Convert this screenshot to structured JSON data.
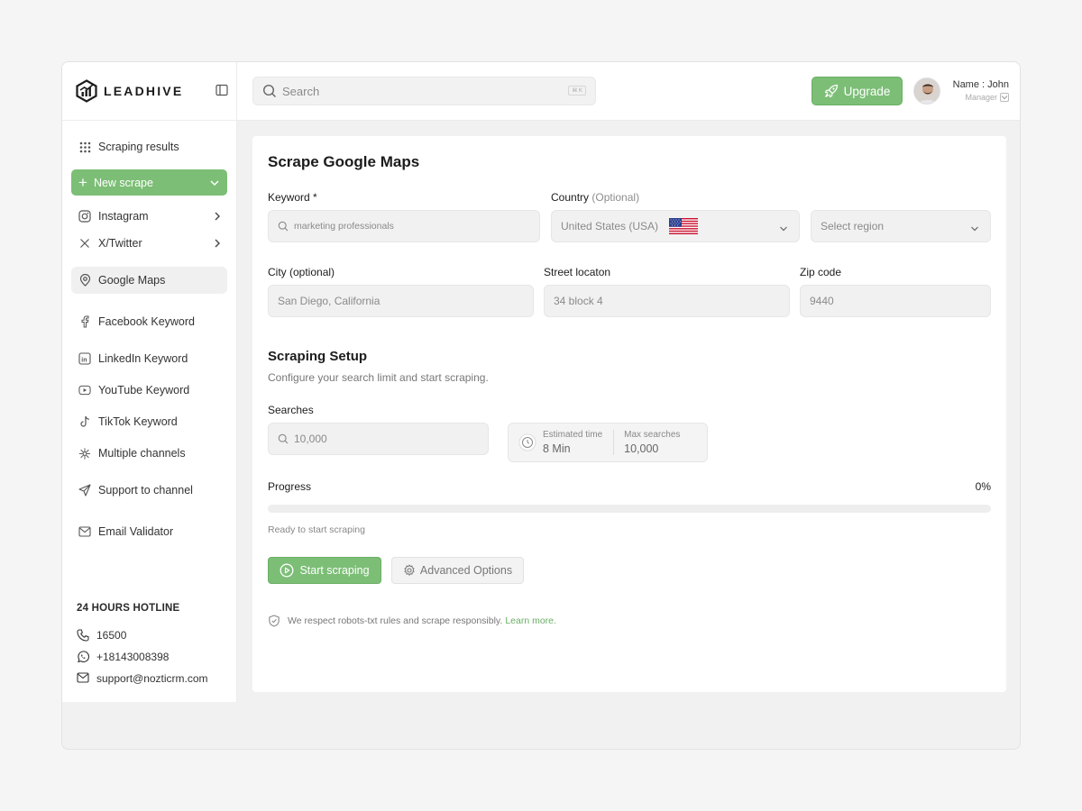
{
  "brand": {
    "name": "LEADHIVE"
  },
  "sidebar": {
    "scraping_results": "Scraping results",
    "new_scrape": "New scrape",
    "items": [
      {
        "label": "Instagram",
        "icon": "instagram-icon"
      },
      {
        "label": "X/Twitter",
        "icon": "x-twitter-icon"
      },
      {
        "label": "Google Maps",
        "icon": "map-pin-icon"
      },
      {
        "label": "Facebook Keyword",
        "icon": "facebook-icon"
      },
      {
        "label": "LinkedIn Keyword",
        "icon": "linkedin-icon"
      },
      {
        "label": "YouTube Keyword",
        "icon": "youtube-icon"
      },
      {
        "label": "TikTok Keyword",
        "icon": "tiktok-icon"
      },
      {
        "label": "Multiple channels",
        "icon": "network-icon"
      },
      {
        "label": "Support to channel",
        "icon": "send-icon"
      },
      {
        "label": "Email Validator",
        "icon": "mail-icon"
      }
    ],
    "hotline": {
      "title": "24 HOURS HOTLINE",
      "phone": "16500",
      "whatsapp": "+18143008398",
      "email": "support@nozticrm.com"
    }
  },
  "header": {
    "search_placeholder": "Search",
    "search_shortcut": "⌘ K",
    "upgrade": "Upgrade",
    "user_name": "Name : John",
    "user_role": "Manager"
  },
  "form": {
    "title": "Scrape Google Maps",
    "keyword_label": "Keyword *",
    "keyword_placeholder": "marketing professionals",
    "country_label": "Country",
    "country_optional": "(Optional)",
    "country_value": "United States (USA)",
    "region_placeholder": "Select region",
    "city_label": "City (optional)",
    "city_placeholder": "San Diego, California",
    "street_label": "Street locaton",
    "street_placeholder": "34 block 4",
    "zip_label": "Zip code",
    "zip_placeholder": "9440"
  },
  "setup": {
    "title": "Scraping Setup",
    "subtitle": "Configure your search limit and start scraping.",
    "searches_label": "Searches",
    "searches_placeholder": "10,000",
    "estimated_time_label": "Estimated time",
    "estimated_time_value": "8 Min",
    "max_searches_label": "Max searches",
    "max_searches_value": "10,000",
    "progress_label": "Progress",
    "progress_text": "0%",
    "progress_value": 0,
    "status": "Ready to start scraping",
    "start_button": "Start scraping",
    "advanced_button": "Advanced Options",
    "note": "We respect robots-txt rules and scrape responsibly.",
    "learn_more": "Learn more."
  },
  "colors": {
    "accent": "#7cbe76",
    "accent_border": "#6aaf64"
  }
}
